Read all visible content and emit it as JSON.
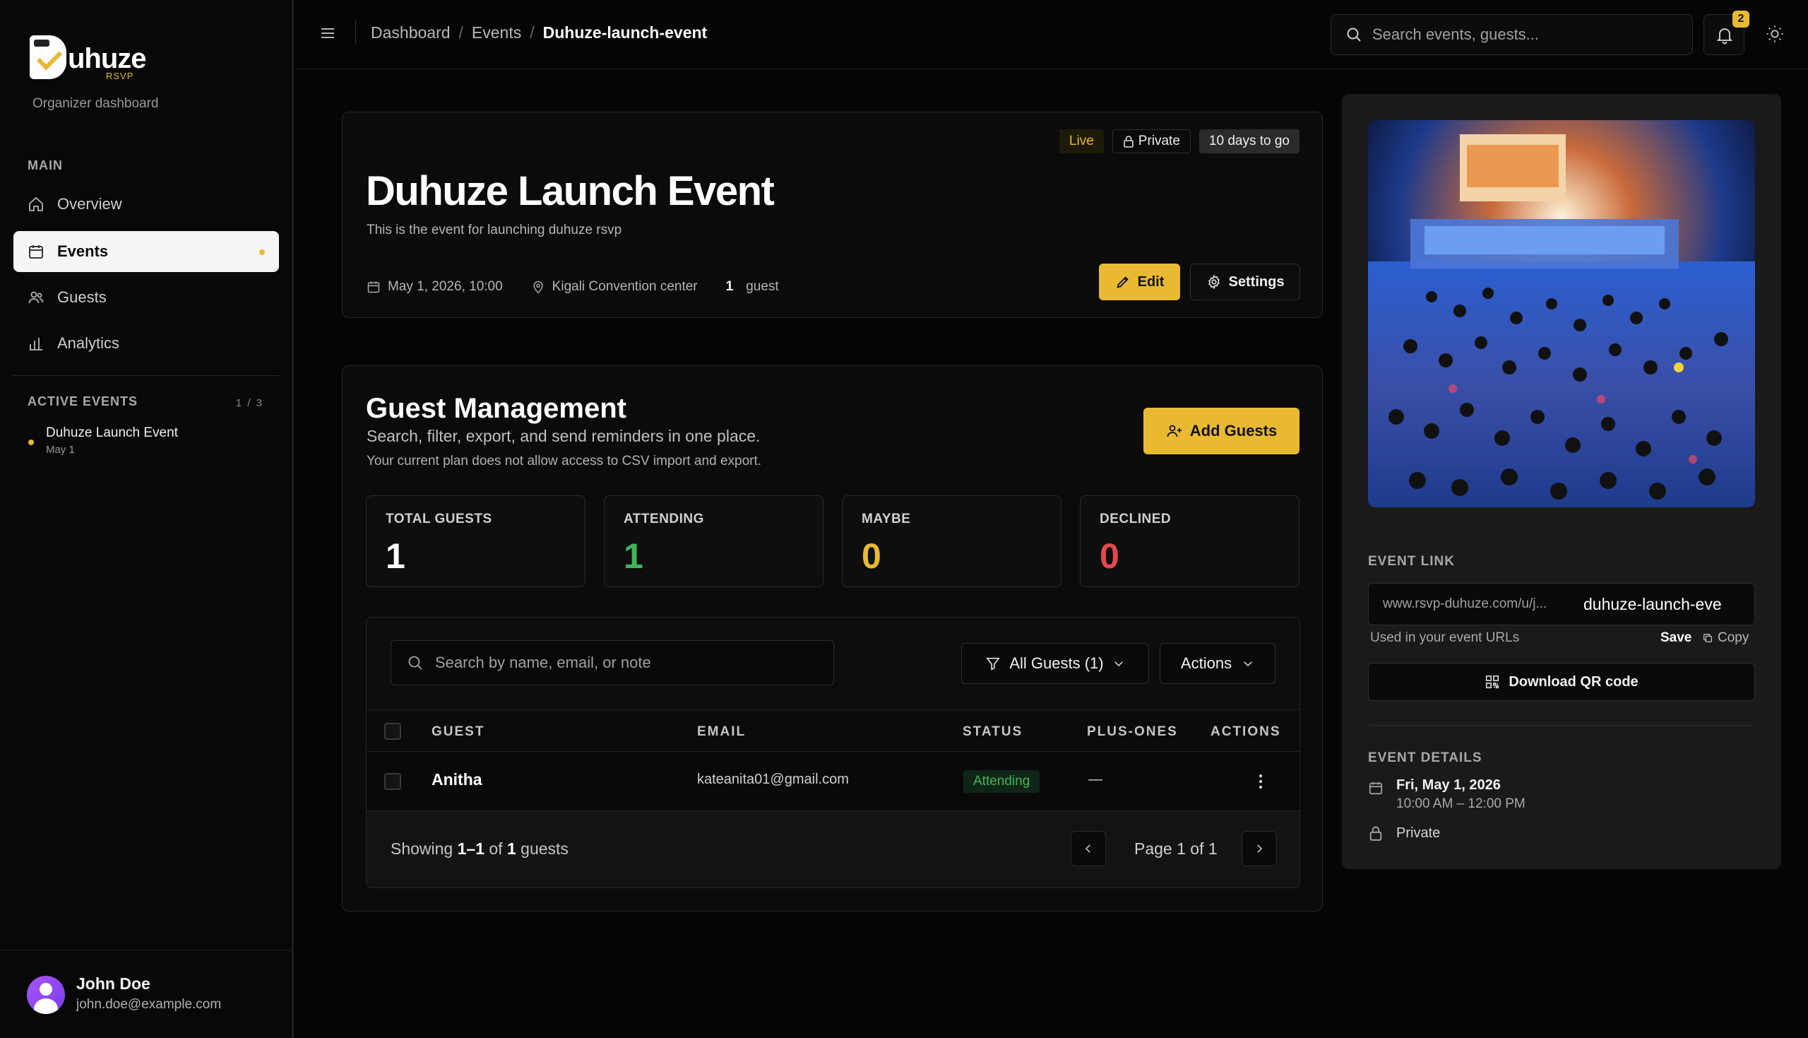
{
  "sidebar": {
    "logo_text": "uhuze",
    "logo_sub": "RSVP",
    "subtitle": "Organizer dashboard",
    "main_label": "MAIN",
    "nav": [
      {
        "label": "Overview"
      },
      {
        "label": "Events"
      },
      {
        "label": "Guests"
      },
      {
        "label": "Analytics"
      }
    ],
    "active_label": "ACTIVE EVENTS",
    "active_count": "1 / 3",
    "active_events": [
      {
        "name": "Duhuze Launch Event",
        "date": "May 1"
      }
    ],
    "user": {
      "name": "John Doe",
      "email": "john.doe@example.com"
    }
  },
  "topbar": {
    "breadcrumb": [
      "Dashboard",
      "Events",
      "Duhuze-launch-event"
    ],
    "search_placeholder": "Search events, guests...",
    "notifications": "2"
  },
  "event": {
    "title": "Duhuze Launch Event",
    "description": "This is the event for launching duhuze rsvp",
    "pills": {
      "live": "Live",
      "private": "Private",
      "countdown": "10 days to go"
    },
    "date": "May 1, 2026, 10:00",
    "location": "Kigali Convention center",
    "guest_count": "1",
    "guest_word": "guest",
    "edit_label": "Edit",
    "settings_label": "Settings"
  },
  "guests": {
    "title": "Guest Management",
    "subtitle": "Search, filter, export, and send reminders in one place.",
    "plan_note": "Your current plan does not allow access to CSV import and export.",
    "add_label": "Add Guests",
    "stats": [
      {
        "label": "TOTAL GUESTS",
        "value": "1",
        "color": "#ffffff"
      },
      {
        "label": "ATTENDING",
        "value": "1",
        "color": "#3fb45c"
      },
      {
        "label": "MAYBE",
        "value": "0",
        "color": "#e8b931"
      },
      {
        "label": "DECLINED",
        "value": "0",
        "color": "#e5484d"
      }
    ],
    "search_placeholder": "Search by name, email, or note",
    "filter_label": "All Guests (1)",
    "actions_label": "Actions",
    "columns": [
      "GUEST",
      "EMAIL",
      "STATUS",
      "PLUS-ONES",
      "ACTIONS"
    ],
    "rows": [
      {
        "name": "Anitha",
        "email": "kateanita01@gmail.com",
        "status": "Attending",
        "plus_ones": "—"
      }
    ],
    "footer": {
      "showing_prefix": "Showing",
      "range": "1–1",
      "of": "of",
      "total": "1",
      "suffix": "guests",
      "page": "Page 1 of 1"
    }
  },
  "panel": {
    "link_label": "EVENT LINK",
    "link_prefix": "www.rsvp-duhuze.com/u/j...",
    "link_slug": "duhuze-launch-eve",
    "link_note": "Used in your event URLs",
    "save_label": "Save",
    "copy_label": "Copy",
    "qr_label": "Download QR code",
    "details_label": "EVENT DETAILS",
    "detail_date": "Fri, May 1, 2026",
    "detail_time": "10:00 AM – 12:00 PM",
    "detail_privacy": "Private"
  }
}
